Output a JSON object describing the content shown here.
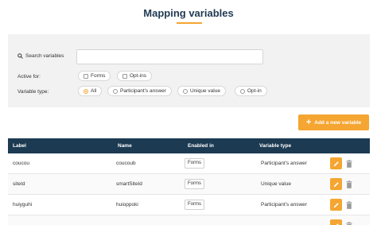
{
  "page": {
    "title": "Mapping variables"
  },
  "filters": {
    "search_label": "Search variables",
    "search_value": "",
    "search_placeholder": "",
    "active_for_label": "Active for:",
    "active_for_options": [
      {
        "label": "Forms",
        "checked": false
      },
      {
        "label": "Opt-ins",
        "checked": false
      }
    ],
    "variable_type_label": "Variable type:",
    "variable_type_options": [
      {
        "label": "All",
        "selected": true
      },
      {
        "label": "Participant's answer",
        "selected": false
      },
      {
        "label": "Unique value",
        "selected": false
      },
      {
        "label": "Opt-in",
        "selected": false
      }
    ]
  },
  "actions": {
    "add_variable_label": "Add a new variable"
  },
  "table": {
    "columns": [
      "Label",
      "Name",
      "Enabled in",
      "Variable type"
    ],
    "rows": [
      {
        "label": "coucou",
        "name": "coucoub",
        "enabled_in": "Forms",
        "variable_type": "Participant's answer"
      },
      {
        "label": "siteId",
        "name": "smartSiteId",
        "enabled_in": "Forms",
        "variable_type": "Unique value"
      },
      {
        "label": "huiyguhi",
        "name": "huioppoki",
        "enabled_in": "Forms",
        "variable_type": "Participant's answer"
      }
    ]
  },
  "colors": {
    "accent": "#f5a531",
    "header_bg": "#1c3a52",
    "panel_bg": "#f2f2f2",
    "title": "#1f3a52"
  }
}
